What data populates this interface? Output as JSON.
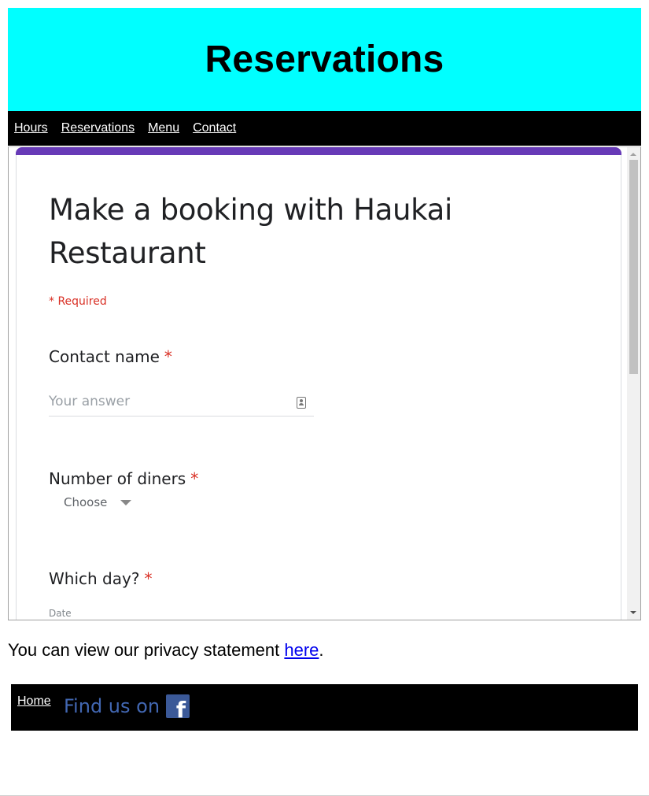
{
  "header": {
    "title": "Reservations"
  },
  "nav": {
    "items": [
      {
        "label": "Hours"
      },
      {
        "label": "Reservations"
      },
      {
        "label": "Menu"
      },
      {
        "label": "Contact"
      }
    ]
  },
  "form": {
    "accent_color": "#673ab7",
    "title": "Make a booking with Haukai Restaurant",
    "required_note": "* Required",
    "questions": [
      {
        "label": "Contact name",
        "required_mark": "*",
        "placeholder": "Your answer",
        "icon": "contact-card-icon"
      },
      {
        "label": "Number of diners",
        "required_mark": "*",
        "dropdown_value": "Choose"
      },
      {
        "label": "Which day?",
        "required_mark": "*",
        "caption": "Date"
      }
    ]
  },
  "privacy": {
    "prefix": "You can view our privacy statement ",
    "link_text": "here",
    "suffix": "."
  },
  "footer": {
    "home_label": "Home",
    "find_us_text": "Find us on",
    "social_icon": "facebook-icon",
    "facebook_color": "#3b5998"
  },
  "colors": {
    "header_bg": "#00ffff",
    "nav_bg": "#000000",
    "required_red": "#d93025",
    "link_blue": "#0000ee"
  }
}
